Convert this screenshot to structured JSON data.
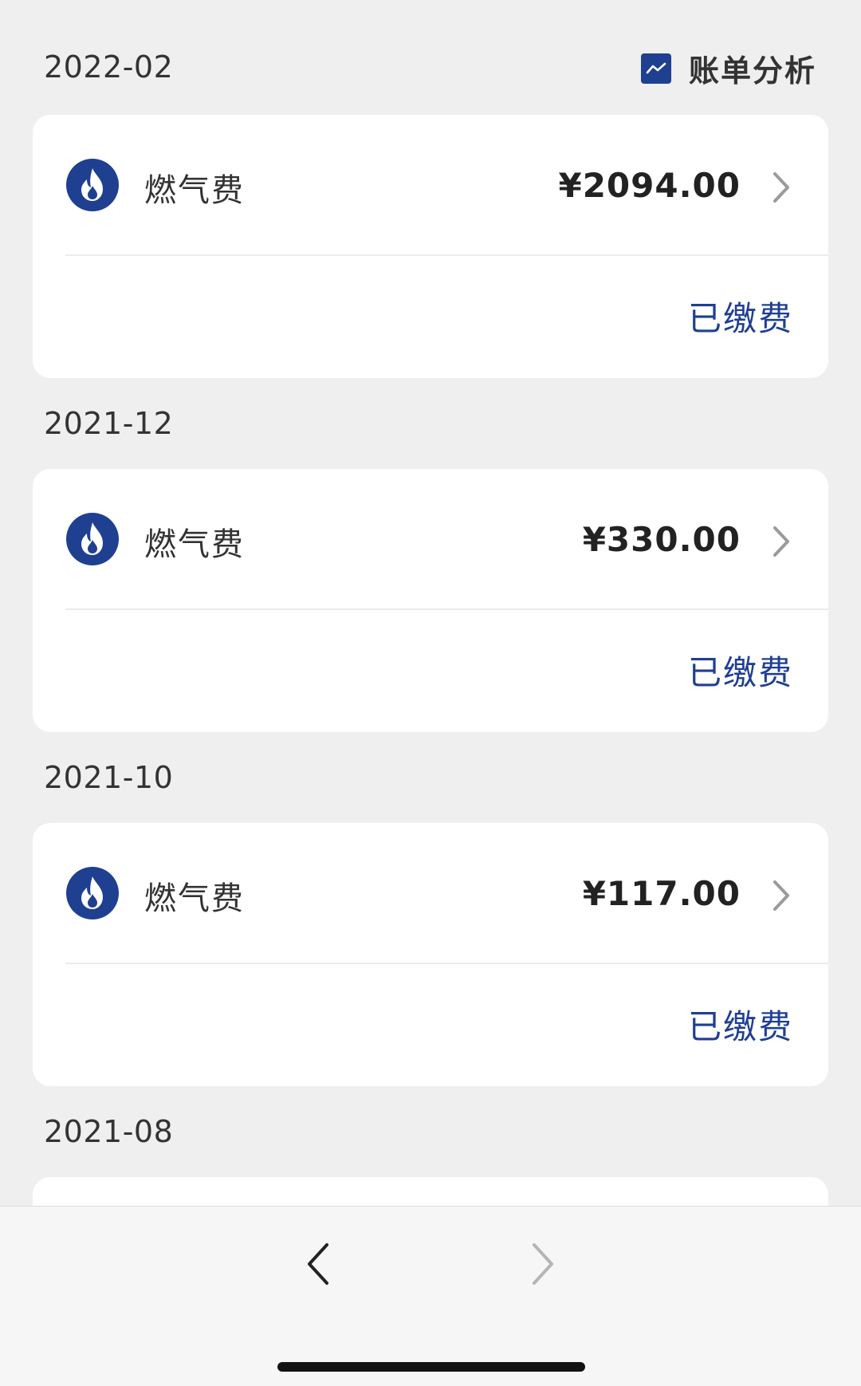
{
  "header": {
    "analysis_label": "账单分析",
    "analysis_icon": "trend-chart-icon"
  },
  "colors": {
    "accent": "#1f3f91",
    "background": "#efefef",
    "card": "#ffffff"
  },
  "bills": [
    {
      "month": "2022-02",
      "name": "燃气费",
      "amount": "¥2094.00",
      "status": "已缴费",
      "icon": "flame-icon"
    },
    {
      "month": "2021-12",
      "name": "燃气费",
      "amount": "¥330.00",
      "status": "已缴费",
      "icon": "flame-icon"
    },
    {
      "month": "2021-10",
      "name": "燃气费",
      "amount": "¥117.00",
      "status": "已缴费",
      "icon": "flame-icon"
    },
    {
      "month": "2021-08"
    }
  ],
  "bottom_nav": {
    "back_icon": "chevron-left-icon",
    "forward_icon": "chevron-right-icon"
  }
}
